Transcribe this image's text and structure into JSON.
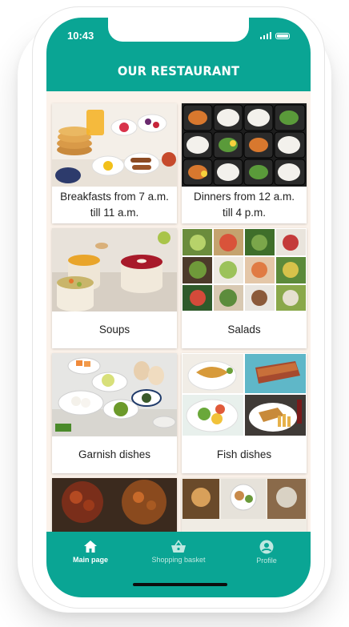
{
  "status_bar": {
    "time": "10:43"
  },
  "header": {
    "title": "OUR RESTAURANT"
  },
  "categories": [
    {
      "label": "Breakfasts from 7 a.m. till 11 a.m."
    },
    {
      "label": "Dinners from 12 a.m. till 4 p.m."
    },
    {
      "label": "Soups"
    },
    {
      "label": "Salads"
    },
    {
      "label": "Garnish dishes"
    },
    {
      "label": "Fish dishes"
    }
  ],
  "bottom_nav": {
    "items": [
      {
        "label": "Main page",
        "icon": "home-icon",
        "active": true
      },
      {
        "label": "Shopping basket",
        "icon": "basket-icon",
        "active": false
      },
      {
        "label": "Profile",
        "icon": "profile-icon",
        "active": false
      }
    ]
  },
  "colors": {
    "accent": "#0aa594",
    "background": "#fbf2ea"
  }
}
